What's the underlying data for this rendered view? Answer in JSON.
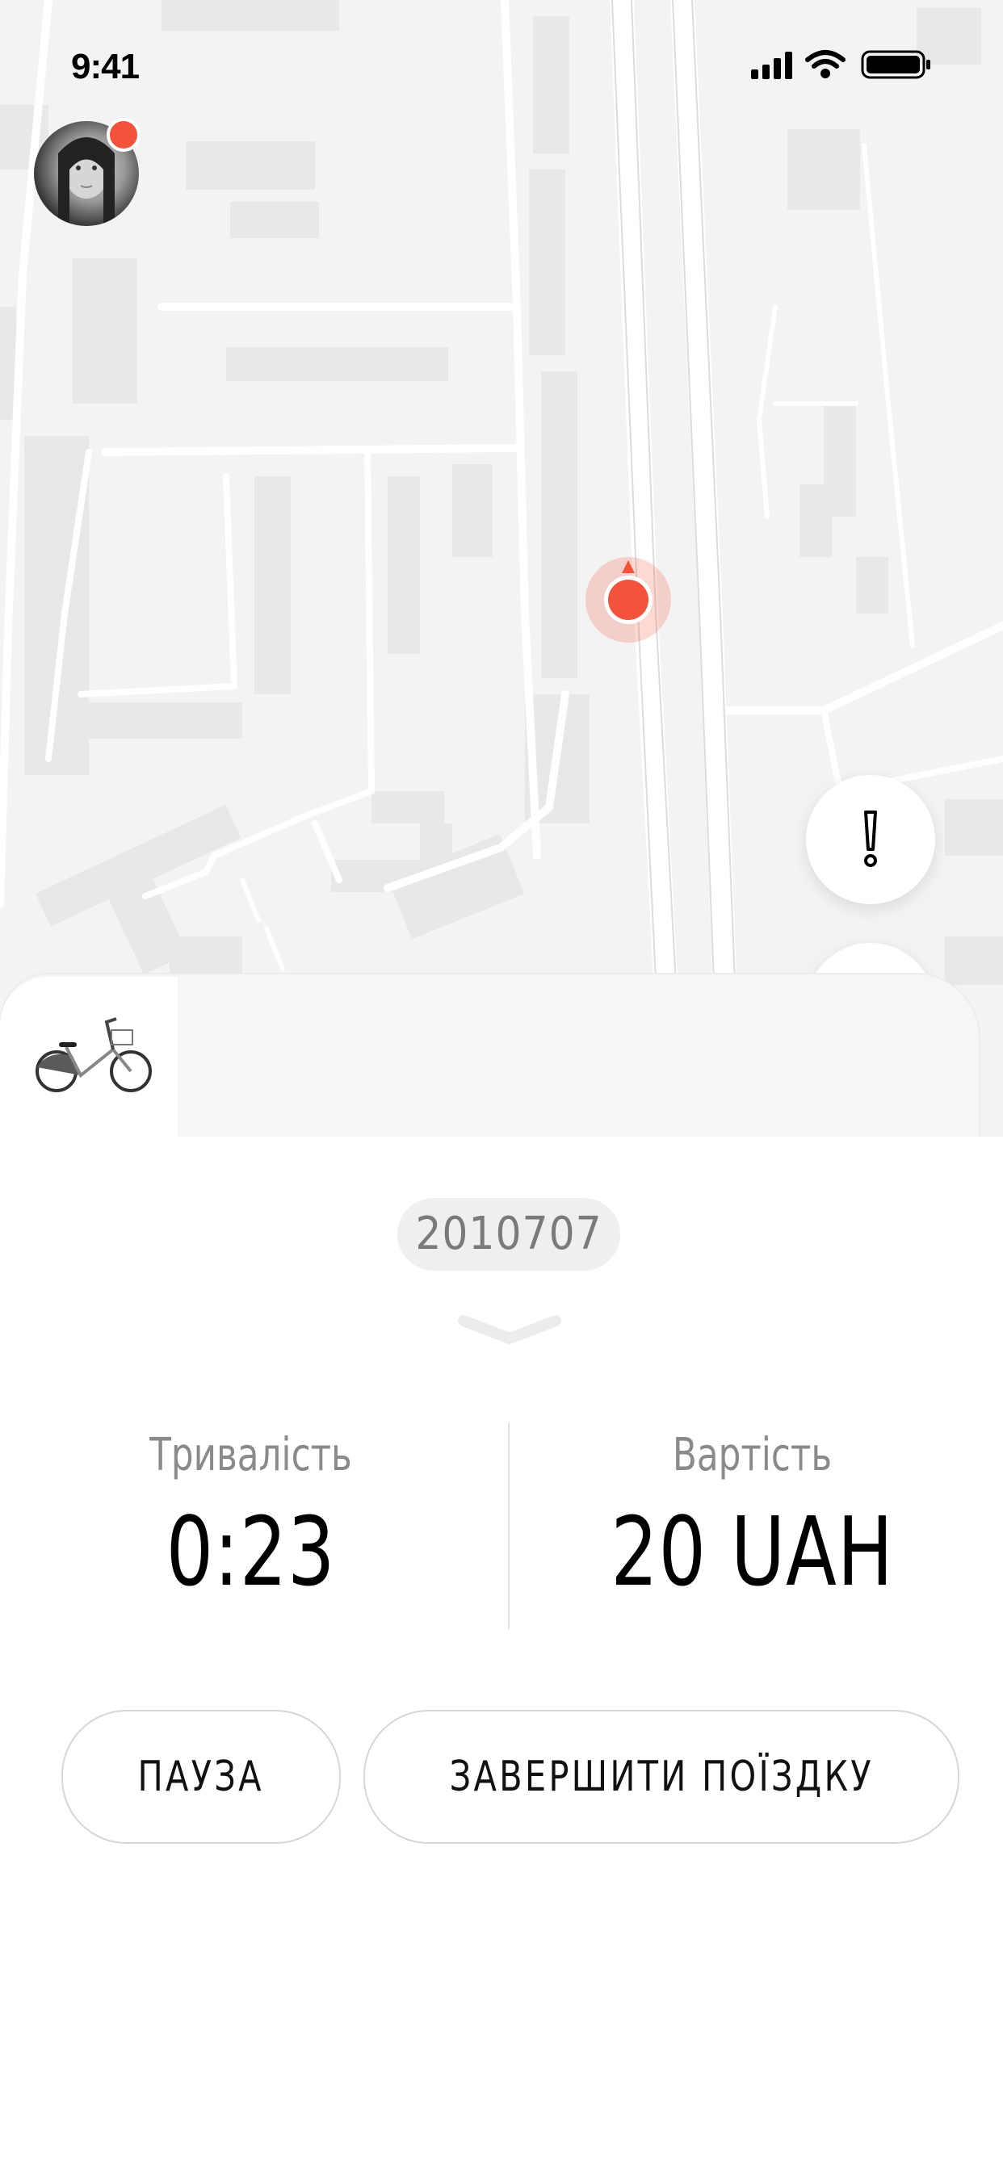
{
  "status_bar": {
    "time": "9:41"
  },
  "colors": {
    "accent": "#f4533b",
    "map_bg": "#f3f3f3"
  },
  "icons": {
    "avatar": "user-avatar",
    "notification": "notification-dot",
    "location": "location-pin-icon",
    "alert": "exclamation-icon",
    "bike": "bicycle-icon",
    "chevron": "chevron-down-icon"
  },
  "ride": {
    "bike_id": "2010707",
    "duration_label": "Тривалість",
    "duration_value": "0:23",
    "cost_label": "Вартість",
    "cost_value": "20 UAH"
  },
  "actions": {
    "pause_label": "ПАУЗА",
    "end_label": "ЗАВЕРШИТИ ПОЇЗДКУ"
  }
}
